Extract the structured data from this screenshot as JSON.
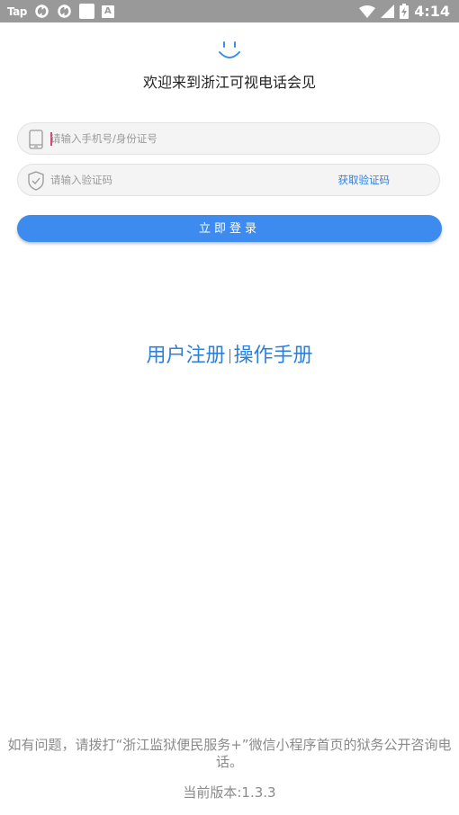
{
  "status_bar": {
    "app_label": "Tap",
    "time": "4:14",
    "left_icons": [
      "sync-icon",
      "sync-icon",
      "white-square-icon",
      "a-badge-icon"
    ],
    "right_icons": [
      "wifi-icon",
      "signal-icon",
      "battery-charging-icon"
    ]
  },
  "header": {
    "logo_icon": "smile-icon",
    "welcome": "欢迎来到浙江可视电话会见"
  },
  "form": {
    "phone_placeholder": "请输入手机号/身份证号",
    "phone_icon": "phone-icon",
    "code_placeholder": "请输入验证码",
    "code_icon": "shield-check-icon",
    "get_code_label": "获取验证码",
    "login_label": "立即登录"
  },
  "links": {
    "register": "用户注册",
    "manual": "操作手册"
  },
  "footer": {
    "notice": "如有问题，请拨打“浙江监狱便民服务+”微信小程序首页的狱务公开咨询电话。",
    "version": "当前版本:1.3.3"
  },
  "colors": {
    "accent": "#3d8bef",
    "link": "#2f80d8",
    "status_bar": "#999999",
    "muted_text": "#8a8a8a"
  }
}
